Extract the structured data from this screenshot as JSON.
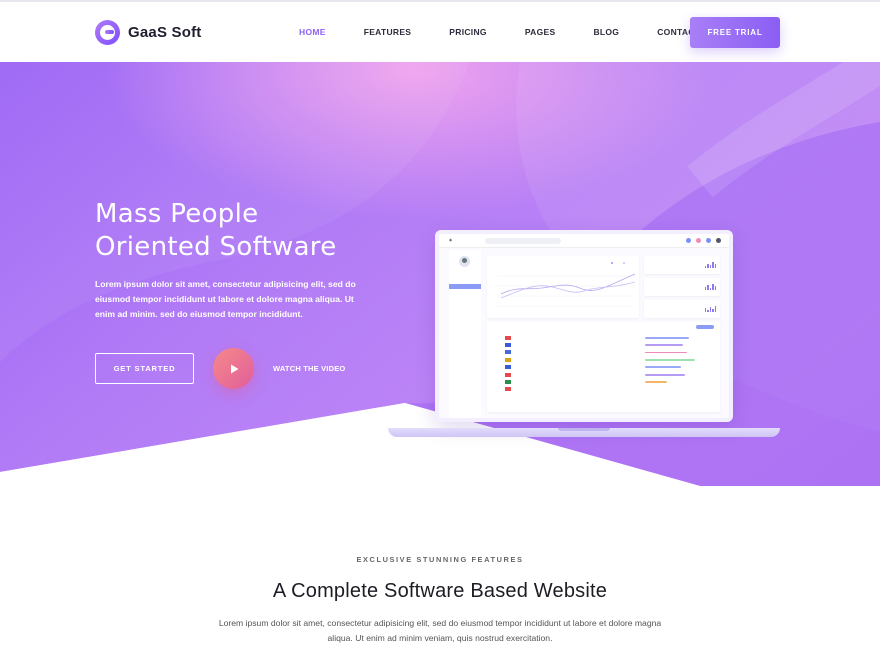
{
  "brand": {
    "name": "GaaS Soft"
  },
  "nav": {
    "items": [
      {
        "label": "HOME",
        "active": true
      },
      {
        "label": "FEATURES",
        "active": false
      },
      {
        "label": "PRICING",
        "active": false
      },
      {
        "label": "PAGES",
        "active": false
      },
      {
        "label": "BLOG",
        "active": false
      },
      {
        "label": "CONTACT",
        "active": false
      }
    ],
    "cta_label": "FREE TRIAL"
  },
  "hero": {
    "title_line1": "Mass People",
    "title_line2": "Oriented Software",
    "text": "Lorem ipsum dolor sit amet, consectetur adipisicing elit, sed do eiusmod tempor incididunt ut labore et dolore magna aliqua. Ut enim ad minim. sed do eiusmod tempor incididunt.",
    "start_label": "GET STARTED",
    "video_label": "WATCH THE VIDEO",
    "play_icon": "play-icon"
  },
  "colors": {
    "accent": "#8a63f2",
    "hero_gradient_start": "#9a5cf5",
    "hero_gradient_end": "#c48af6",
    "play_gradient_start": "#f58a8a",
    "play_gradient_end": "#e25d9a"
  },
  "features": {
    "kicker": "EXCLUSIVE STUNNING FEATURES",
    "title": "A Complete Software Based Website",
    "text": "Lorem ipsum dolor sit amet, consectetur adipisicing elit, sed do eiusmod tempor incididunt ut labore et dolore magna aliqua. Ut enim ad minim veniam, quis nostrud exercitation."
  }
}
